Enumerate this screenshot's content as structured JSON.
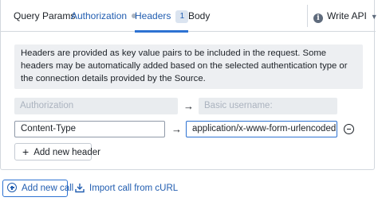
{
  "tabs": {
    "query_params": "Query Params",
    "authorization": "Authorization",
    "headers": "Headers",
    "headers_count": "1",
    "body": "Body"
  },
  "write_api": {
    "label": "Write API",
    "icon": "info-icon"
  },
  "callout_text": "Headers are provided as key value pairs to be included in the request. Some headers may be automatically added based on the selected authentication type or the connection details provided by the Source.",
  "headers_rows": [
    {
      "key": "Authorization",
      "value": "Basic username:",
      "disabled": true
    },
    {
      "key": "Content-Type",
      "value": "application/x-www-form-urlencoded",
      "disabled": false
    }
  ],
  "add_header_label": "Add new header",
  "add_call_label": "Add new call",
  "import_call_label": "Import call from cURL",
  "colors": {
    "accent": "#2d72d2",
    "link": "#215db0",
    "border": "#d3d8de",
    "callout_bg": "#edeff2",
    "disabled_bg": "#e9ecef"
  }
}
